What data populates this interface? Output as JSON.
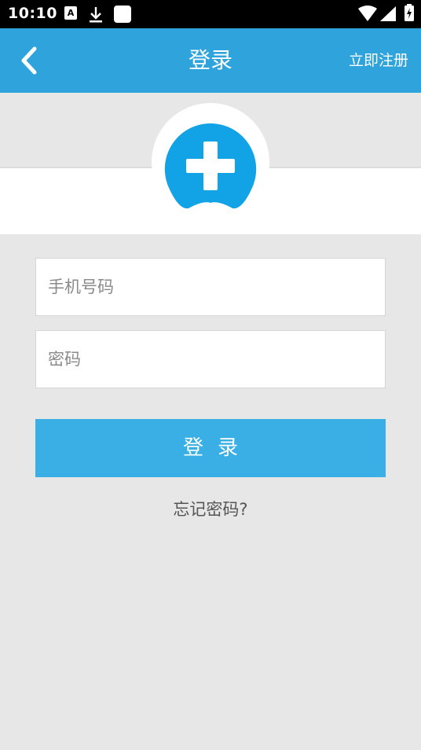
{
  "status_bar": {
    "time": "10:10",
    "a_badge": "A",
    "icons": [
      "a-notification-icon",
      "download-icon",
      "app-notification-icon",
      "wifi-icon",
      "cell-signal-icon",
      "battery-icon"
    ]
  },
  "app_bar": {
    "title": "登录",
    "register_label": "立即注册",
    "back_icon": "chevron-left-icon",
    "color": "#2fa3db"
  },
  "logo": {
    "icon": "medical-plus-logo",
    "color": "#12a3e6"
  },
  "form": {
    "phone_placeholder": "手机号码",
    "phone_value": "",
    "password_placeholder": "密码",
    "password_value": "",
    "login_label": "登录",
    "login_color": "#39afe5",
    "forgot_label": "忘记密码?"
  }
}
